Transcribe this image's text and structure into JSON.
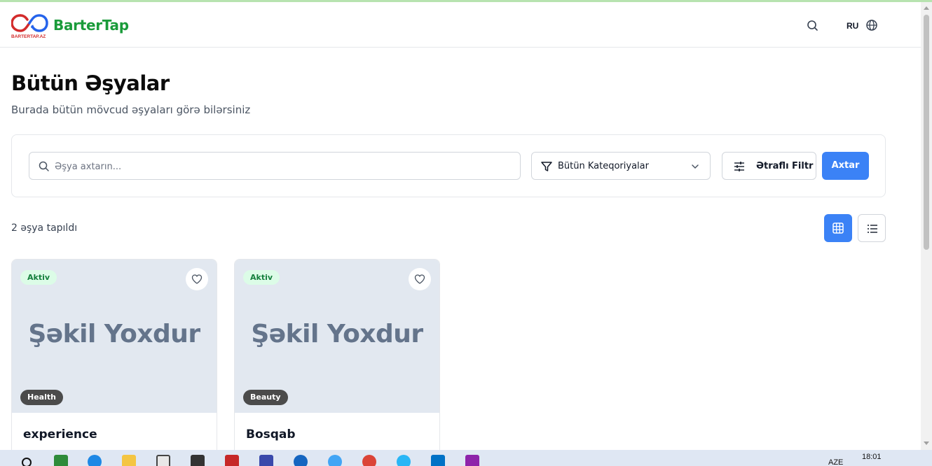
{
  "header": {
    "logo_text": "BARTERTAP.AZ",
    "brand": "BarterTap",
    "language": "RU",
    "icons": [
      "search-icon",
      "globe-icon"
    ]
  },
  "page": {
    "title": "Bütün Əşyalar",
    "subtitle": "Burada bütün mövcud əşyaları görə bilərsiniz"
  },
  "filters": {
    "search_placeholder": "Əşya axtarın...",
    "category_selected": "Bütün Kateqoriyalar",
    "advanced_label": "Ətraflı Filtr",
    "search_button": "Axtar"
  },
  "results": {
    "count_text": "2 əşya tapıldı",
    "active_view": "grid"
  },
  "items": [
    {
      "status": "Aktiv",
      "placeholder": "Şəkil Yoxdur",
      "category": "Health",
      "name": "experience"
    },
    {
      "status": "Aktiv",
      "placeholder": "Şəkil Yoxdur",
      "category": "Beauty",
      "name": "Bosqab"
    }
  ],
  "taskbar": {
    "language": "AZE",
    "time": "18:01"
  },
  "colors": {
    "brand": "#1a9b3a",
    "primary": "#3b82f6",
    "status_bg": "#dcfce7",
    "status_text": "#15803d",
    "image_bg": "#e2e8f0",
    "category_bg": "#4b4b4b"
  }
}
